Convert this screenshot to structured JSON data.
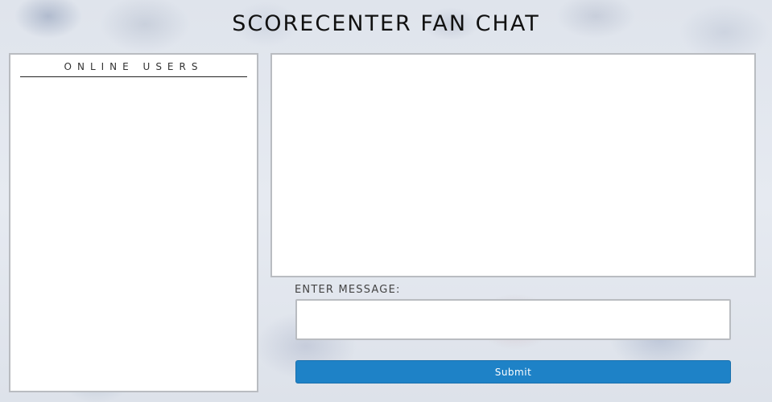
{
  "header": {
    "title": "SCORECENTER FAN CHAT"
  },
  "users_panel": {
    "title": "ONLINE USERS",
    "users": []
  },
  "chat": {
    "messages": []
  },
  "composer": {
    "label": "ENTER MESSAGE:",
    "value": "",
    "placeholder": "",
    "submit_label": "Submit"
  },
  "colors": {
    "submit_button": "#1e82c7",
    "panel_border": "#b9bcc1",
    "title_text": "#111111"
  }
}
